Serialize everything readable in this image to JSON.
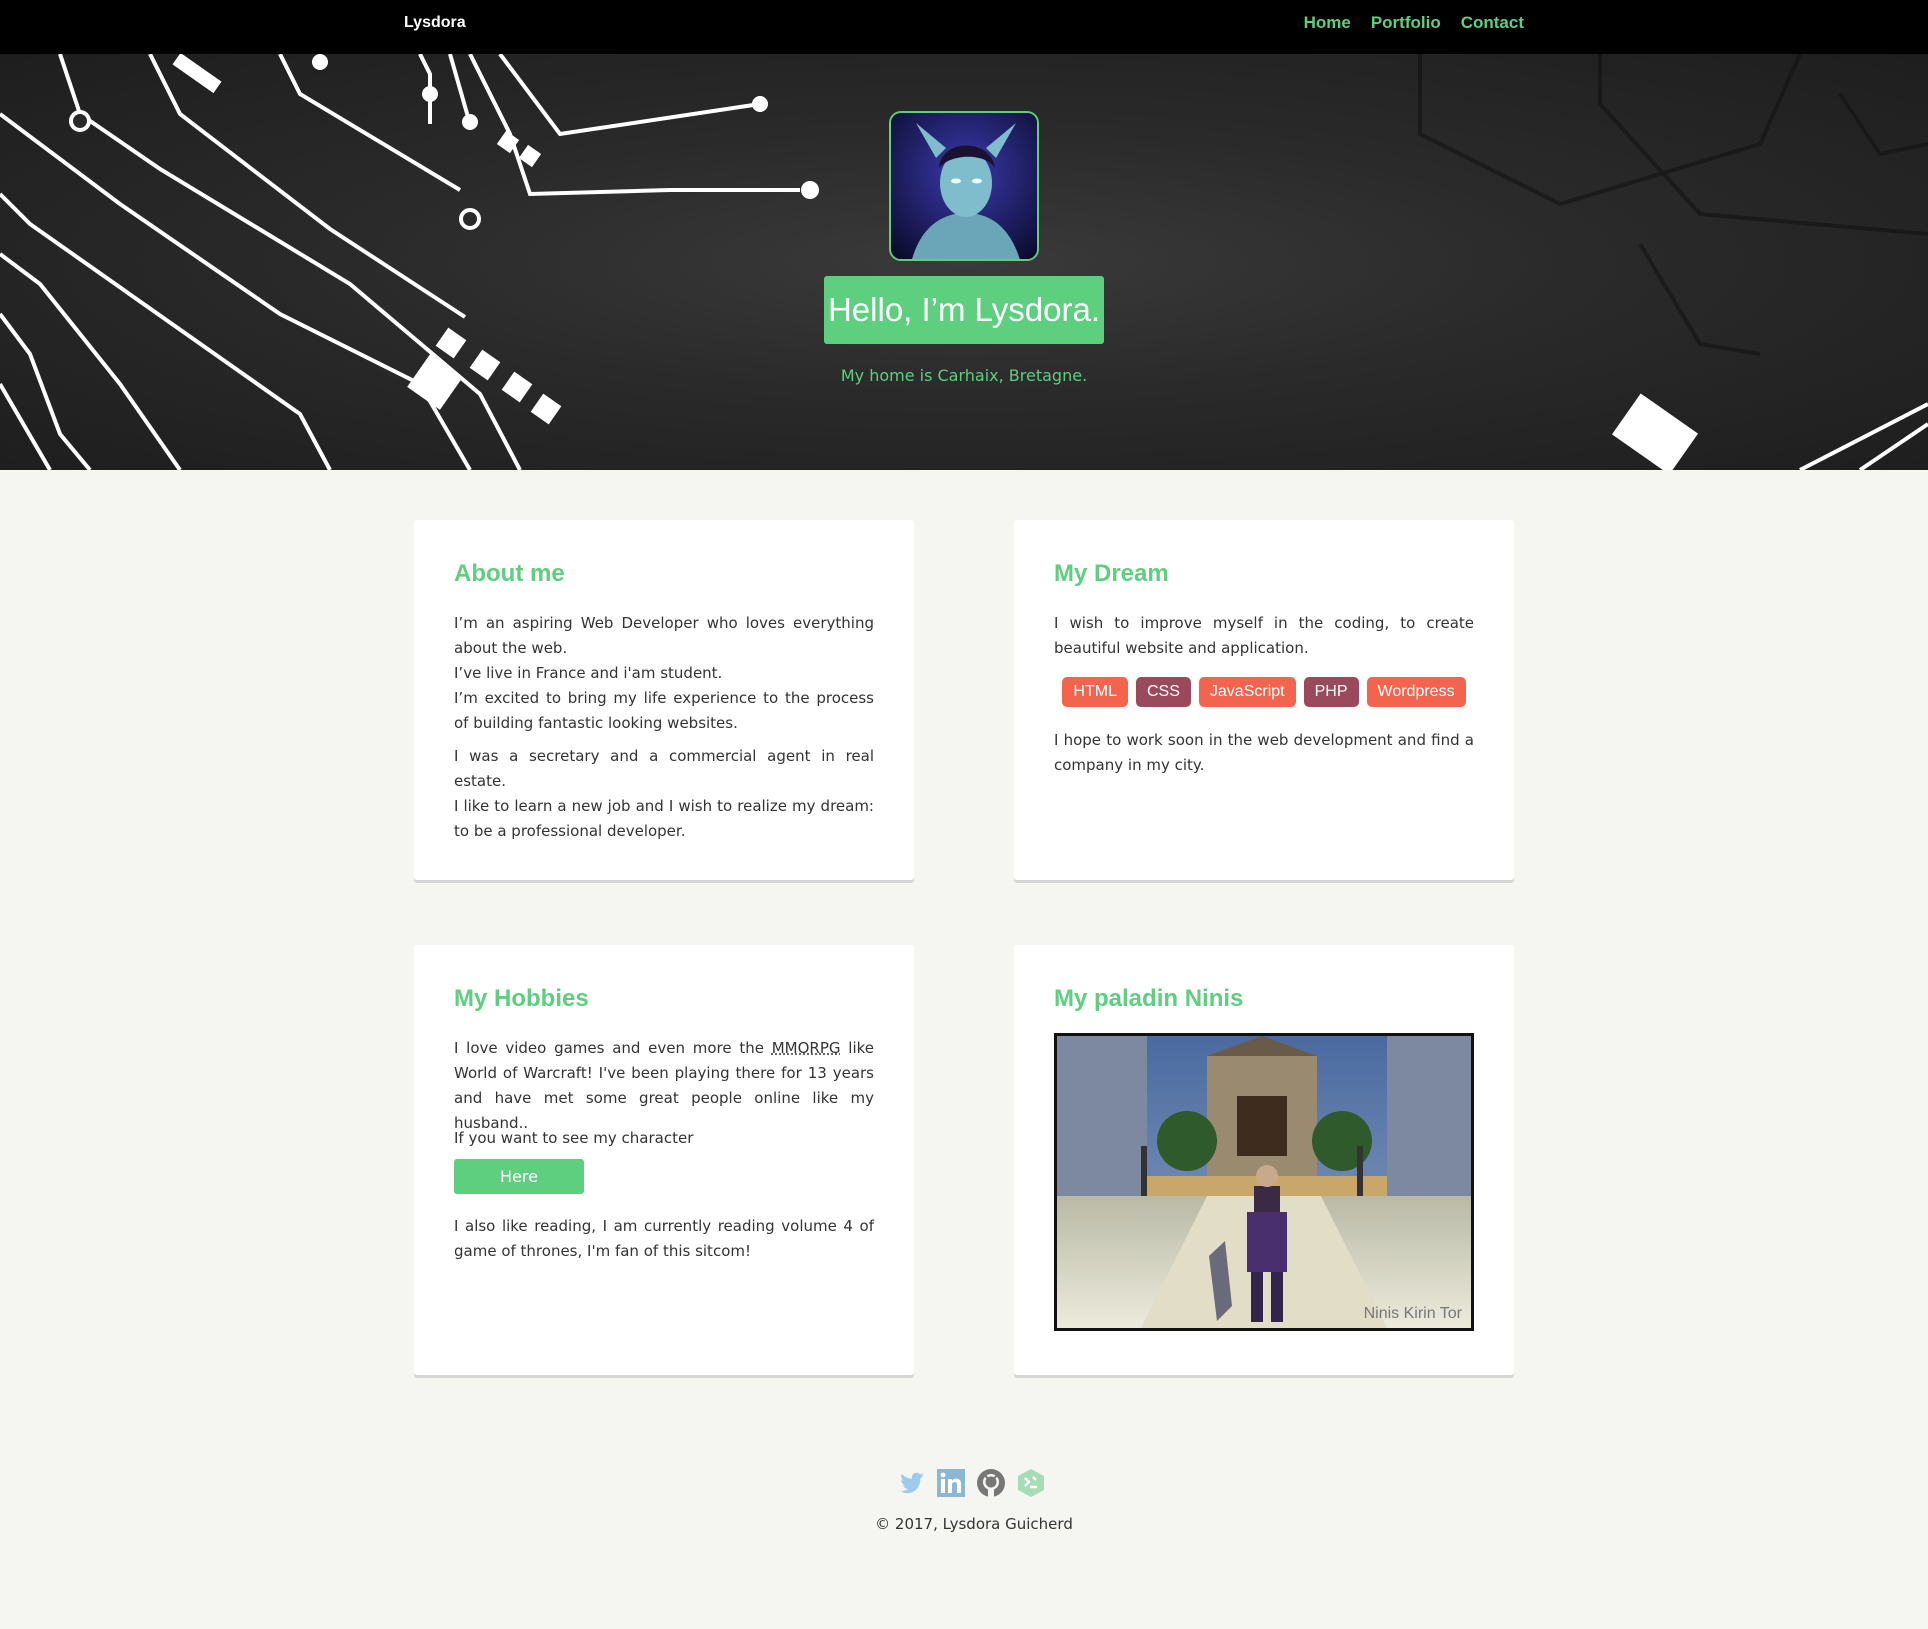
{
  "nav": {
    "brand": "Lysdora",
    "links": [
      "Home",
      "Portfolio",
      "Contact"
    ]
  },
  "hero": {
    "title": "Hello, I’m Lysdora.",
    "subtitle": "My home is Carhaix, Bretagne."
  },
  "about": {
    "title": "About me",
    "p1_lines": [
      "I’m an aspiring Web Developer who loves everything about the web.",
      "I’ve live in France and i'am student.",
      "I’m excited to bring my life experience to the process of building fantastic looking websites."
    ],
    "p2_lines": [
      "I was a secretary and a commercial agent in real estate.",
      "I like to learn a new job and I wish to realize my dream: to be a professional developer."
    ]
  },
  "dream": {
    "title": "My Dream",
    "p1": "I wish to improve myself in the coding, to create beautiful website and application.",
    "tags": [
      "HTML",
      "CSS",
      "JavaScript",
      "PHP",
      "Wordpress"
    ],
    "p2": "I hope to work soon in the web development and find a company in my city."
  },
  "hobbies": {
    "title": "My Hobbies",
    "p1_before": "I love video games and even more the ",
    "p1_abbr": "MMORPG",
    "p1_after": " like World of Warcraft! I've been playing there for 13 years and have met some great people online like my husband..",
    "p2": "If you want to see my character",
    "button": "Here",
    "p3": "I also like reading, I am currently reading volume 4 of game of thrones, I'm fan of this sitcom!"
  },
  "paladin": {
    "title": "My paladin Ninis",
    "caption": "Ninis Kirin Tor"
  },
  "footer": {
    "social_icons": [
      "twitter-icon",
      "linkedin-icon",
      "github-icon",
      "freecodecamp-icon"
    ],
    "copyright": "© 2017, Lysdora Guicherd"
  },
  "colors": {
    "accent": "#5dcf7e",
    "tag_red": "#f2644e",
    "tag_plum": "#9b4a5e",
    "navbar": "#000000",
    "page_bg": "#f5f5f1"
  }
}
